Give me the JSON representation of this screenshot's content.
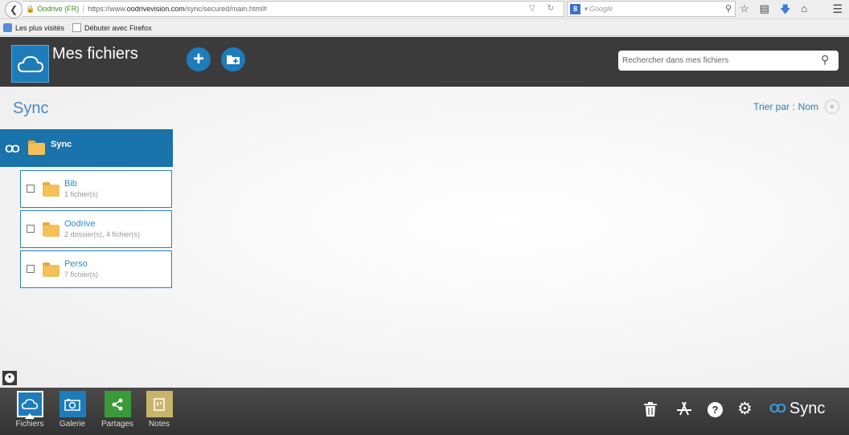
{
  "browser": {
    "site_identity": "Oodrive (FR)",
    "url_prefix": "https://www.",
    "url_domain": "oodrivevision.com",
    "url_path": "/sync/secured/main.html#",
    "search_engine_placeholder": "Google",
    "bookmarks": [
      "Les plus visités",
      "Débuter avec Firefox"
    ]
  },
  "header": {
    "title": "Mes fichiers",
    "search_placeholder": "Rechercher dans mes fichiers"
  },
  "main": {
    "page_title": "Sync",
    "sort_label": "Trier par :",
    "sort_value": "Nom",
    "current_folder": "Sync",
    "folders": [
      {
        "name": "Bib",
        "count": "1 fichier(s)"
      },
      {
        "name": "Oodrive",
        "count": "2 dossier(s), 4 fichier(s)"
      },
      {
        "name": "Perso",
        "count": "7 fichier(s)"
      }
    ]
  },
  "bottom_nav": [
    {
      "label": "Fichiers"
    },
    {
      "label": "Galerie"
    },
    {
      "label": "Partages"
    },
    {
      "label": "Notes"
    }
  ],
  "brand": {
    "name": "Sync"
  },
  "colors": {
    "accent": "#1e7cba",
    "header_bg": "#3b3b3b",
    "link": "#2a8cd0"
  },
  "icons": [
    "back-arrow-icon",
    "lock-icon",
    "search-icon",
    "star-icon",
    "download-icon",
    "home-icon",
    "menu-icon",
    "cloud-icon",
    "plus-icon",
    "new-folder-icon",
    "sync-link-icon",
    "folder-icon",
    "camera-icon",
    "share-icon",
    "notes-icon",
    "trash-icon",
    "appstore-icon",
    "help-icon",
    "gear-icon"
  ]
}
